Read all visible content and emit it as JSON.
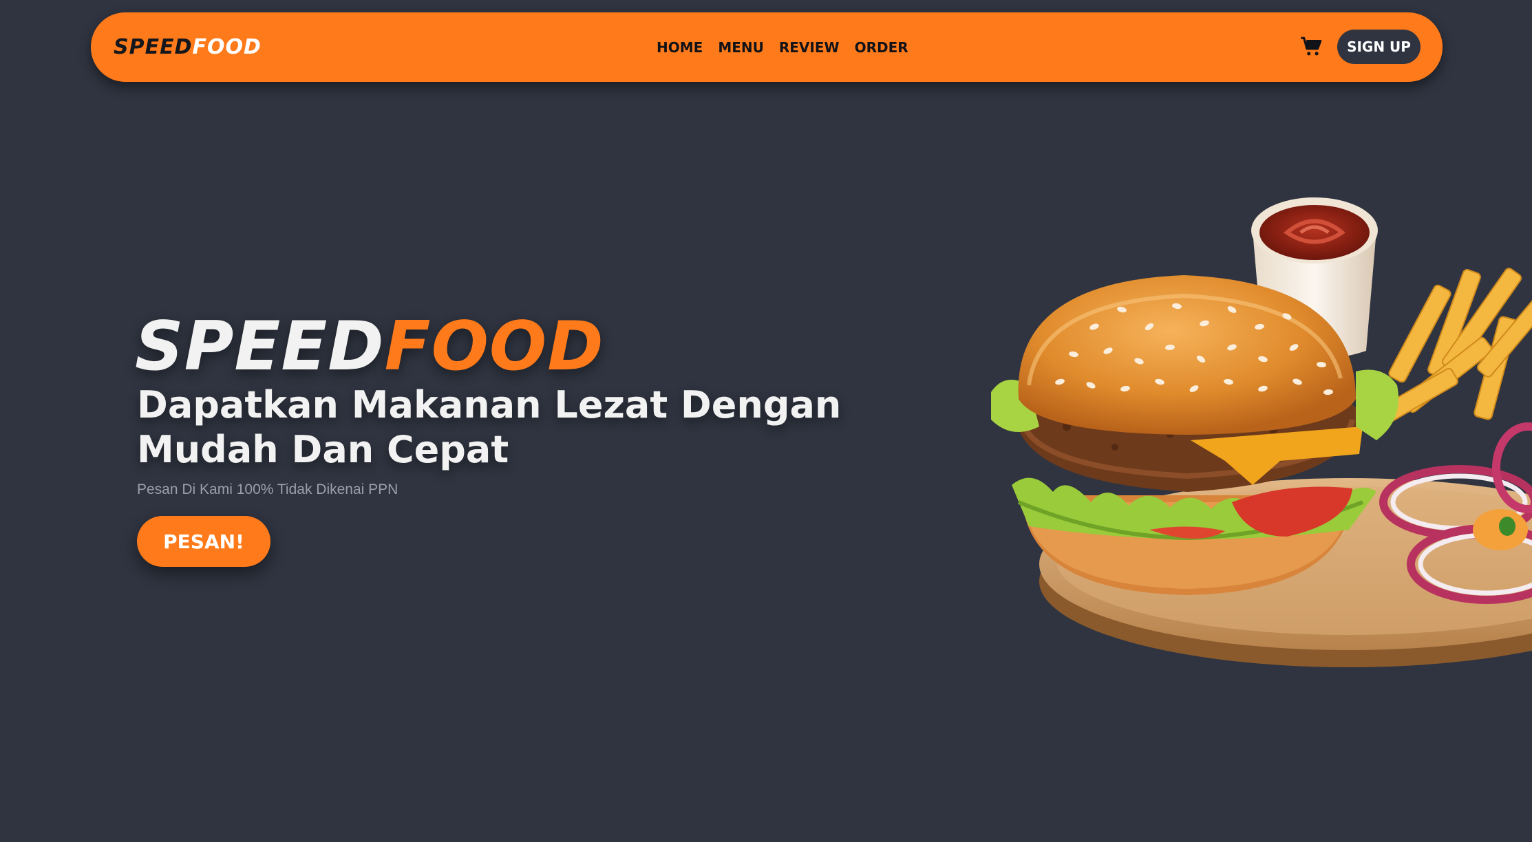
{
  "colors": {
    "background": "#2f3440",
    "accent": "#ff7a1a",
    "nav_text": "#111318",
    "light_text": "#f2f2f2",
    "muted_text": "#9aa0aa"
  },
  "nav": {
    "logo": {
      "part1": "SPEED",
      "part2": "FOOD"
    },
    "links": [
      "HOME",
      "MENU",
      "REVIEW",
      "ORDER"
    ],
    "cart_icon": "shopping-cart-icon",
    "signup_label": "SIGN UP"
  },
  "hero": {
    "title": {
      "part1": "SPEED",
      "part2": "FOOD"
    },
    "subtitle": "Dapatkan Makanan Lezat Dengan Mudah Dan Cepat",
    "note": "Pesan Di Kami 100% Tidak Dikenai PPN",
    "button_label": "PESAN!",
    "image": "burger-fries-plate-illustration"
  }
}
